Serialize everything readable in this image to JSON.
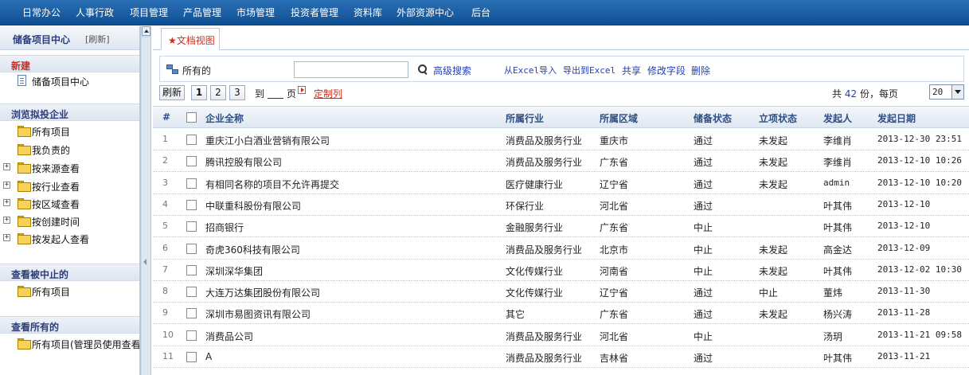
{
  "topmenu": [
    "日常办公",
    "人事行政",
    "项目管理",
    "产品管理",
    "市场管理",
    "投资者管理",
    "资料库",
    "外部资源中心",
    "后台"
  ],
  "sidebar": {
    "title": "储备项目中心",
    "refresh": "[刷新]",
    "new_section": "新建",
    "new_item": "储备项目中心",
    "browse_section": "浏览拟投企业",
    "browse_items": [
      "所有项目",
      "我负责的",
      "按来源查看",
      "按行业查看",
      "按区域查看",
      "按创建时间",
      "按发起人查看"
    ],
    "suspended_section": "查看被中止的",
    "suspended_item": "所有项目",
    "all_section": "查看所有的",
    "all_item": "所有项目(管理员使用查看"
  },
  "tab": {
    "label": "★文档视图"
  },
  "toolbar": {
    "all_label": "所有的",
    "search_value": "",
    "advanced_search": "高级搜索",
    "import_excel": "从Excel导入",
    "export_excel": "导出到Excel",
    "share": "共享",
    "edit_fields": "修改字段",
    "delete": "删除"
  },
  "pager": {
    "refresh": "刷新",
    "pages": [
      "1",
      "2",
      "3"
    ],
    "goto_prefix": "到",
    "goto_suffix": "页",
    "custom_columns": "定制列",
    "total_prefix": "共",
    "total_count": "42",
    "total_suffix": "份，每页",
    "per_page": "20"
  },
  "table": {
    "headers": {
      "num": "#",
      "name": "企业全称",
      "industry": "所属行业",
      "region": "所属区域",
      "reserve": "储备状态",
      "approval": "立项状态",
      "initiator": "发起人",
      "date": "发起日期"
    },
    "rows": [
      {
        "num": "1",
        "name": "重庆江小白酒业营销有限公司",
        "industry": "消费品及服务行业",
        "region": "重庆市",
        "reserve": "通过",
        "approval": "未发起",
        "initiator": "李维肖",
        "date": "2013-12-30 23:51"
      },
      {
        "num": "2",
        "name": "腾讯控股有限公司",
        "industry": "消费品及服务行业",
        "region": "广东省",
        "reserve": "通过",
        "approval": "未发起",
        "initiator": "李维肖",
        "date": "2013-12-10 10:26"
      },
      {
        "num": "3",
        "name": "有相同名称的项目不允许再提交",
        "industry": "医疗健康行业",
        "region": "辽宁省",
        "reserve": "通过",
        "approval": "未发起",
        "initiator": "admin",
        "date": "2013-12-10 10:20"
      },
      {
        "num": "4",
        "name": "中联重科股份有限公司",
        "industry": "环保行业",
        "region": "河北省",
        "reserve": "通过",
        "approval": "",
        "initiator": "叶其伟",
        "date": "2013-12-10"
      },
      {
        "num": "5",
        "name": "招商银行",
        "industry": "金融服务行业",
        "region": "广东省",
        "reserve": "中止",
        "approval": "",
        "initiator": "叶其伟",
        "date": "2013-12-10"
      },
      {
        "num": "6",
        "name": "奇虎360科技有限公司",
        "industry": "消费品及服务行业",
        "region": "北京市",
        "reserve": "中止",
        "approval": "未发起",
        "initiator": "高金达",
        "date": "2013-12-09"
      },
      {
        "num": "7",
        "name": "深圳深华集团",
        "industry": "文化传媒行业",
        "region": "河南省",
        "reserve": "中止",
        "approval": "未发起",
        "initiator": "叶其伟",
        "date": "2013-12-02 10:30"
      },
      {
        "num": "8",
        "name": "大连万达集团股份有限公司",
        "industry": "文化传媒行业",
        "region": "辽宁省",
        "reserve": "通过",
        "approval": "中止",
        "initiator": "董炜",
        "date": "2013-11-30"
      },
      {
        "num": "9",
        "name": "深圳市易图资讯有限公司",
        "industry": "其它",
        "region": "广东省",
        "reserve": "通过",
        "approval": "未发起",
        "initiator": "杨兴涛",
        "date": "2013-11-28"
      },
      {
        "num": "10",
        "name": "消费品公司",
        "industry": "消费品及服务行业",
        "region": "河北省",
        "reserve": "中止",
        "approval": "",
        "initiator": "汤玥",
        "date": "2013-11-21 09:58"
      },
      {
        "num": "11",
        "name": "A",
        "industry": "消费品及服务行业",
        "region": "吉林省",
        "reserve": "通过",
        "approval": "",
        "initiator": "叶其伟",
        "date": "2013-11-21"
      }
    ]
  }
}
